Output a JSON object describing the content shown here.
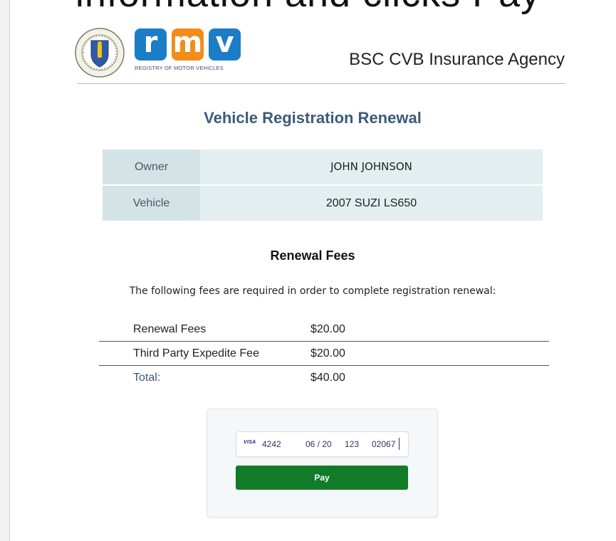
{
  "overlay": {
    "caption": "information and clicks Pay"
  },
  "header": {
    "rmv_letters": [
      "r",
      "m",
      "v"
    ],
    "rmv_subtitle": "REGISTRY OF MOTOR VEHICLES",
    "agency_name": "BSC CVB Insurance Agency",
    "colors": {
      "rmv_blue": "#1b7dc6",
      "rmv_orange": "#f28c1a"
    }
  },
  "page_title": "Vehicle Registration Renewal",
  "info": {
    "owner_label": "Owner",
    "owner_value": "JOHN JOHNSON",
    "vehicle_label": "Vehicle",
    "vehicle_value": "2007 SUZI LS650"
  },
  "fees": {
    "title": "Renewal Fees",
    "intro": "The following fees are required in order to complete registration renewal:",
    "rows": [
      {
        "name": "Renewal Fees",
        "amount": "$20.00"
      },
      {
        "name": "Third Party Expedite Fee",
        "amount": "$20.00"
      },
      {
        "name": "Total:",
        "amount": "$40.00"
      }
    ]
  },
  "payment": {
    "card_brand": "VISA",
    "card_number": "4242",
    "expiry": "06 / 20",
    "cvc": "123",
    "zip": "02067",
    "pay_label": "Pay",
    "pay_color": "#117b28"
  }
}
